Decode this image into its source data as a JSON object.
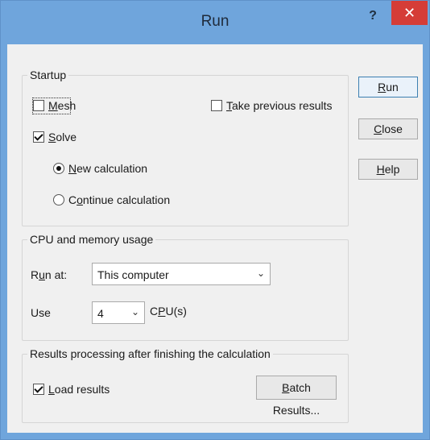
{
  "window": {
    "title": "Run",
    "help_glyph": "?",
    "close_glyph": "✕"
  },
  "startup": {
    "legend": "Startup",
    "mesh": {
      "hot": "M",
      "rest": "esh",
      "checked": false
    },
    "take_previous": {
      "hot": "T",
      "rest": "ake previous results",
      "checked": false
    },
    "solve": {
      "hot": "S",
      "rest": "olve",
      "checked": true
    },
    "new_calc": {
      "hot": "N",
      "rest": "ew calculation",
      "checked": true
    },
    "continue_calc": {
      "pre": "C",
      "hot": "o",
      "rest": "ntinue calculation",
      "checked": false
    }
  },
  "cpu": {
    "legend": "CPU and memory usage",
    "run_at": {
      "pre": "R",
      "hot": "u",
      "rest": "n at:",
      "value": "This computer"
    },
    "use": {
      "label": "Use",
      "value": "4",
      "suffix_pre": "C",
      "suffix_hot": "P",
      "suffix_rest": "U(s)"
    }
  },
  "results": {
    "legend": "Results processing after finishing the calculation",
    "load": {
      "hot": "L",
      "rest": "oad results",
      "checked": true
    },
    "batch": {
      "hot": "B",
      "rest": "atch Results..."
    }
  },
  "buttons": {
    "run": {
      "hot": "R",
      "rest": "un"
    },
    "close": {
      "hot": "C",
      "rest": "lose"
    },
    "help": {
      "hot": "H",
      "rest": "elp"
    }
  },
  "icons": {
    "dropdown": "chevron-down-icon",
    "check": "checkmark-icon"
  }
}
